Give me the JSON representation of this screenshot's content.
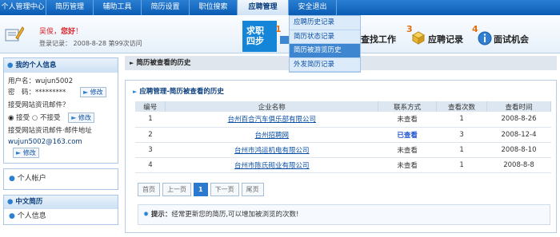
{
  "nav": [
    "个人管理中心",
    "简历管理",
    "辅助工具",
    "简历设置",
    "职位搜索",
    "应聘管理",
    "安全退出"
  ],
  "dropdown": [
    "应聘历史记录",
    "简历状态记录",
    "简历被游览历史",
    "外发简历记录"
  ],
  "user": {
    "name": "吴俊",
    "greeting": "您好",
    "login_label": "登录记录：",
    "login_date": "2008-8-28",
    "login_count": "第99次访问"
  },
  "steps": {
    "title_l1": "求职",
    "title_l2": "四步",
    "step1_num": "1",
    "step2_label": "查找工作",
    "step3_num": "3",
    "step3_label": "应聘记录",
    "step4_num": "4",
    "step4_label": "面试机会"
  },
  "sidebar": {
    "info_title": "我的个人信息",
    "username_label": "用户名：",
    "username": "wujun5002",
    "password_label": "密　码：",
    "password": "*********",
    "modify": "修改",
    "receive_q": "接受网站资讯邮件？",
    "accept": "接受",
    "reject": "不接受",
    "email_label": "接受网站资讯邮件·邮件地址",
    "email": "wujun5002@163.com",
    "account_title": "个人帐户",
    "resume_title": "中文简历",
    "resume_item": "个人信息"
  },
  "main": {
    "title": "简历被查看的历史",
    "subtitle": "应聘管理-简历被查看的历史",
    "columns": [
      "编号",
      "企业名称",
      "联系方式",
      "查看次数",
      "查看时间"
    ],
    "rows": [
      {
        "no": "1",
        "company": "台州百合汽车俱乐部有限公司",
        "contact": "未查看",
        "count": "1",
        "time": "2008-8-26"
      },
      {
        "no": "2",
        "company": "台州招聘网",
        "contact": "已查看",
        "count": "3",
        "time": "2008-12-4"
      },
      {
        "no": "3",
        "company": "台州市鸿运机电有限公司",
        "contact": "未查看",
        "count": "1",
        "time": "2008-8-10"
      },
      {
        "no": "4",
        "company": "台州市陈氏砌业有限公司",
        "contact": "未查看",
        "count": "1",
        "time": "2008-8-8"
      }
    ],
    "pager": [
      "首页",
      "上一页",
      "1",
      "下一页",
      "尾页"
    ],
    "tip_label": "提示：",
    "tip_text": "经常更新您的简历,可以增加被浏览的次数!"
  },
  "colors": {
    "nav_blue": "#0a5cb3",
    "viewed": "#1a4fd0",
    "accent_orange": "#e07012"
  }
}
